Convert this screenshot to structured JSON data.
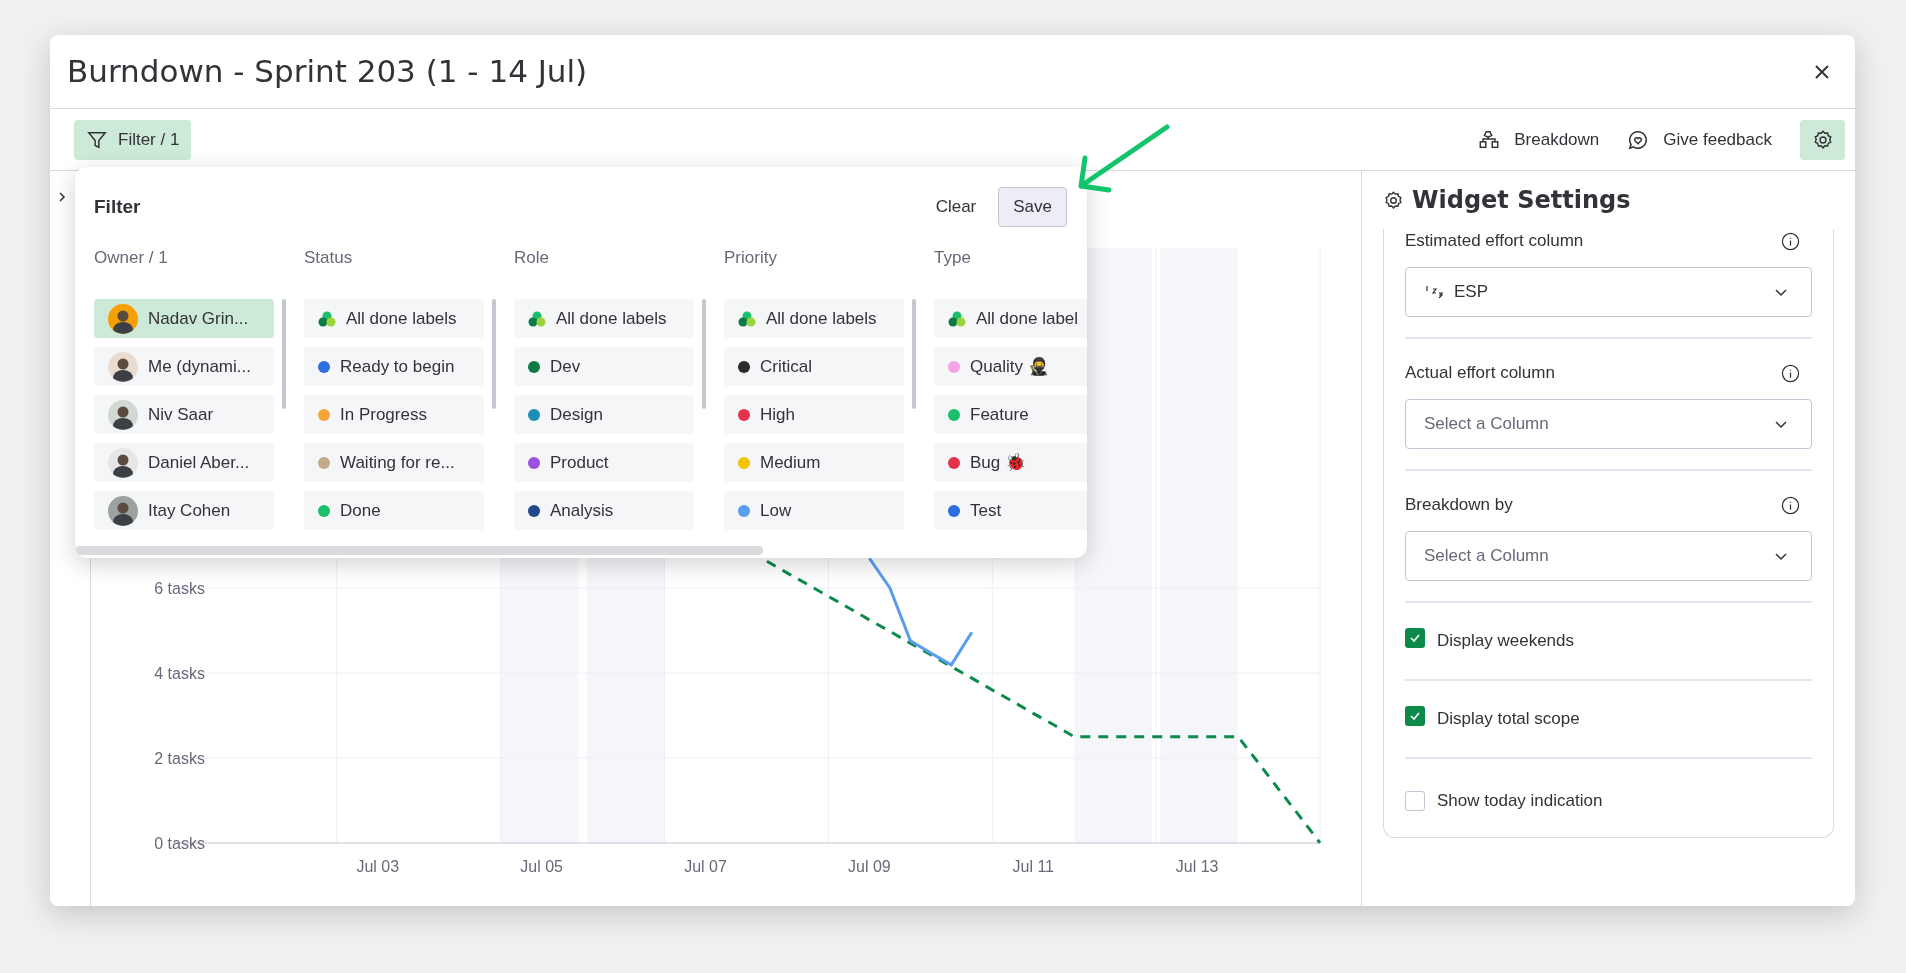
{
  "window": {
    "title": "Burndown - Sprint 203 (1 - 14 Jul)"
  },
  "toolbar": {
    "filter_button": {
      "label": "Filter / 1",
      "selected": true
    },
    "buttons": [
      {
        "label": "Breakdown",
        "kind": "breakdown"
      },
      {
        "label": "Give feedback",
        "kind": "feedback"
      }
    ],
    "settings_button": {
      "selected": true
    }
  },
  "filter": {
    "title": "Filter",
    "clear": "Clear",
    "save": "Save",
    "columns": [
      {
        "title": "Owner / 1",
        "items": [
          {
            "kind": "person",
            "label": "Nadav Grin...",
            "selected": true
          },
          {
            "kind": "person",
            "label": "Me (dynami...",
            "selected": false
          },
          {
            "kind": "person",
            "label": "Niv Saar",
            "selected": false
          },
          {
            "kind": "person",
            "label": "Daniel Aber...",
            "selected": false
          },
          {
            "kind": "person",
            "label": "Itay Cohen",
            "selected": false
          }
        ]
      },
      {
        "title": "Status",
        "items": [
          {
            "kind": "all",
            "label": "All done labels",
            "selected": false
          },
          {
            "kind": "label",
            "label": "Ready to begin",
            "color": "#2f6fe0",
            "selected": false
          },
          {
            "kind": "label",
            "label": "In Progress",
            "color": "#f5a33a",
            "selected": false
          },
          {
            "kind": "label",
            "label": "Waiting for re...",
            "color": "#c4a98a",
            "selected": false
          },
          {
            "kind": "label",
            "label": "Done",
            "color": "#1cbf6b",
            "selected": false
          }
        ]
      },
      {
        "title": "Role",
        "items": [
          {
            "kind": "all",
            "label": "All done labels",
            "selected": false
          },
          {
            "kind": "label",
            "label": "Dev",
            "color": "#0b7a44",
            "selected": false
          },
          {
            "kind": "label",
            "label": "Design",
            "color": "#1b8eb8",
            "selected": false
          },
          {
            "kind": "label",
            "label": "Product",
            "color": "#9b51e0",
            "selected": false
          },
          {
            "kind": "label",
            "label": "Analysis",
            "color": "#214a8c",
            "selected": false
          }
        ]
      },
      {
        "title": "Priority",
        "items": [
          {
            "kind": "all",
            "label": "All done labels",
            "selected": false
          },
          {
            "kind": "label",
            "label": "Critical",
            "color": "#2b2b2b",
            "selected": false
          },
          {
            "kind": "label",
            "label": "High",
            "color": "#e2334a",
            "selected": false
          },
          {
            "kind": "label",
            "label": "Medium",
            "color": "#f5c400",
            "selected": false
          },
          {
            "kind": "label",
            "label": "Low",
            "color": "#5a9cf0",
            "selected": false
          }
        ]
      },
      {
        "title": "Type",
        "items": [
          {
            "kind": "all",
            "label": "All done label",
            "selected": false
          },
          {
            "kind": "label",
            "label": "Quality 🥷",
            "color": "#f4a1e6",
            "selected": false
          },
          {
            "kind": "label",
            "label": "Feature",
            "color": "#1cbf6b",
            "selected": false
          },
          {
            "kind": "label",
            "label": "Bug 🐞",
            "color": "#e2334a",
            "selected": false
          },
          {
            "kind": "label",
            "label": "Test",
            "color": "#2b6ee0",
            "selected": false
          }
        ]
      }
    ]
  },
  "chart": {
    "chart_data": {
      "type": "line",
      "ylim": [
        0,
        14
      ],
      "grid": true,
      "categories": [
        null,
        null,
        null,
        null,
        null,
        null,
        null,
        null,
        null,
        null,
        "Jul 03",
        null,
        null,
        null,
        null,
        null,
        null,
        null,
        "Jul 05",
        null,
        null,
        null,
        null,
        null,
        null,
        null,
        "Jul 07",
        null,
        null,
        null,
        null,
        null,
        null,
        null,
        "Jul 09",
        null,
        null,
        null,
        null,
        null,
        null,
        null,
        "Jul 11",
        null,
        null,
        null,
        null,
        null,
        null,
        null,
        "Jul 13",
        null,
        null,
        null,
        null,
        null,
        null
      ],
      "yticks": [
        {
          "value": 0,
          "label": "0 tasks"
        },
        {
          "value": 2,
          "label": "2 tasks"
        },
        {
          "value": 4,
          "label": "4 tasks"
        },
        {
          "value": 6,
          "label": "6 tasks"
        }
      ],
      "series": [
        {
          "color": "#0b8a4a",
          "line_style": "dashed",
          "values": [
            null,
            null,
            null,
            null,
            null,
            null,
            null,
            null,
            null,
            null,
            null,
            null,
            null,
            null,
            null,
            null,
            null,
            null,
            null,
            null,
            null,
            null,
            null,
            null,
            null,
            null,
            null,
            null,
            null,
            6.63,
            6.35,
            6.08,
            5.8,
            5.53,
            5.25,
            4.98,
            4.7,
            4.43,
            4.15,
            3.88,
            3.6,
            3.33,
            3.05,
            2.78,
            2.5,
            2.5,
            2.5,
            2.5,
            2.5,
            2.5,
            2.5,
            2.5,
            2.5,
            1.88,
            1.25,
            0.63,
            0
          ]
        },
        {
          "color": "#5a9cf0",
          "line_style": "solid",
          "values": [
            null,
            null,
            null,
            null,
            null,
            null,
            null,
            null,
            null,
            null,
            null,
            null,
            null,
            null,
            null,
            null,
            null,
            null,
            null,
            null,
            null,
            null,
            null,
            null,
            null,
            null,
            null,
            null,
            null,
            null,
            null,
            null,
            null,
            null,
            6.7,
            6.0,
            4.76,
            4.47,
            4.19,
            4.96,
            null,
            null,
            null,
            null,
            null,
            null,
            null,
            null,
            null,
            null,
            null,
            null,
            null,
            null,
            null,
            null,
            null
          ]
        }
      ]
    }
  },
  "settings": {
    "title": "Widget Settings",
    "fields": [
      {
        "label": "Estimated effort column",
        "value": "ESP"
      },
      {
        "label": "Actual effort column",
        "placeholder": "Select a Column"
      },
      {
        "label": "Breakdown by",
        "placeholder": "Select a Column"
      }
    ],
    "checkboxes": [
      {
        "label": "Display weekends",
        "checked": true
      },
      {
        "label": "Display total scope",
        "checked": true
      },
      {
        "label": "Show today indication",
        "checked": false
      }
    ]
  }
}
